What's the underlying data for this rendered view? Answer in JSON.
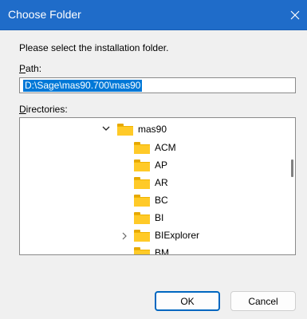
{
  "window": {
    "title": "Choose Folder"
  },
  "prompt": "Please select the installation folder.",
  "path": {
    "label_accel": "P",
    "label_rest": "ath:",
    "value": "D:\\Sage\\mas90.700\\mas90"
  },
  "directories": {
    "label_accel": "D",
    "label_rest": "irectories:"
  },
  "tree": {
    "root": "mas90",
    "children": [
      "ACM",
      "AP",
      "AR",
      "BC",
      "BI",
      "BIExplorer",
      "BM"
    ]
  },
  "buttons": {
    "ok": "OK",
    "cancel": "Cancel"
  },
  "colors": {
    "titlebar": "#1f6cc9",
    "selection": "#0078d7",
    "folder": "#ffca28"
  }
}
